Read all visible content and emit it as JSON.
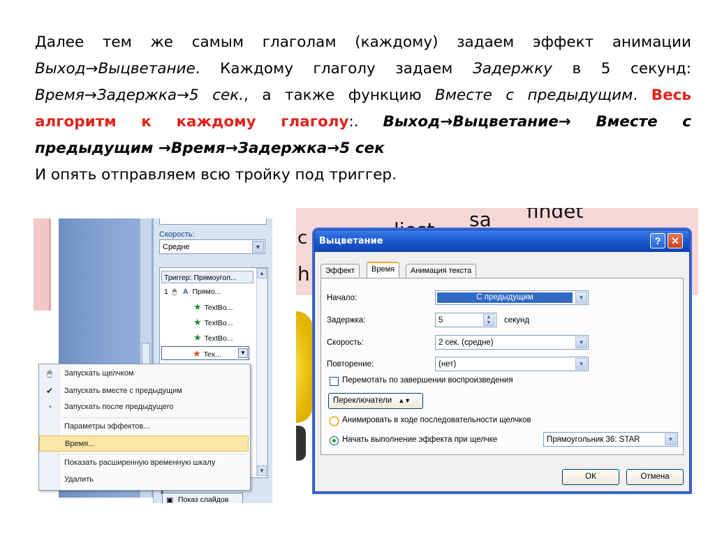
{
  "paragraph": {
    "s1": "Далее тем же самым глаголам (каждому) задаем эффект анимации",
    "s2_it": "Выход→Выцветание",
    "s3": ". Каждому глаголу задаем",
    "s4_it": "Задержку",
    "s5": "в 5 секунд:",
    "s6_it": "Время→Задержка→5 сек.",
    "s7": ", а также функцию",
    "s8_it": "Вместе с предыдущим",
    "s9": ".",
    "s10_red": "Весь алгоритм к каждому глаголу",
    "s11": ":.",
    "s12_bi": "Выход→Выцветание→ Вместе с предыдущим →Время→Задержка→5 сек",
    "s13": "И опять отправляем всю тройку под триггер."
  },
  "left": {
    "speed_label": "Скорость:",
    "speed_value": "Средне",
    "trigger_header": "Триггер: Прямоугол...",
    "row1_num": "1",
    "row1_label": "Прямо...",
    "row2_label": "TextBo...",
    "row3_label": "TextBo...",
    "row4_label": "TextBo...",
    "row5_label": "Tex...",
    "slideshow_button": "Показ слайдов",
    "menu": {
      "start_on_click": "Запускать щелчком",
      "start_with_previous": "Запускать вместе с предыдущим",
      "start_after_previous": "Запускать после предыдущего",
      "effect_options": "Параметры эффектов...",
      "timing": "Время...",
      "show_timeline": "Показать расширенную временную шкалу",
      "remove": "Удалить"
    }
  },
  "right": {
    "bg_words": [
      "sa",
      "liest",
      "findet"
    ],
    "bg_letter_c": "с",
    "bg_letter_h": "h",
    "dialog": {
      "title": "Выцветание",
      "tabs": [
        "Эффект",
        "Время",
        "Анимация текста"
      ],
      "start_label": "Начало:",
      "start_value": "С предыдущим",
      "delay_label": "Задержка:",
      "delay_value": "5",
      "delay_unit": "секунд",
      "speed_label": "Скорость:",
      "speed_value": "2 сек. (средне)",
      "repeat_label": "Повторение:",
      "repeat_value": "(нет)",
      "rewind_label": "Перемотать по завершении воспроизведения",
      "triggers_button": "Переключатели",
      "animate_sequence_label": "Анимировать в ходе последовательности щелчков",
      "start_effect_on_click_label": "Начать выполнение эффекта при щелчке",
      "trigger_target_value": "Прямоугольник 36: STAR",
      "ok": "ОК",
      "cancel": "Отмена"
    }
  },
  "colors": {
    "accent_red": "#e0221c",
    "xp_title_blue": "#1c5bd0",
    "selection_blue": "#316ac5"
  }
}
